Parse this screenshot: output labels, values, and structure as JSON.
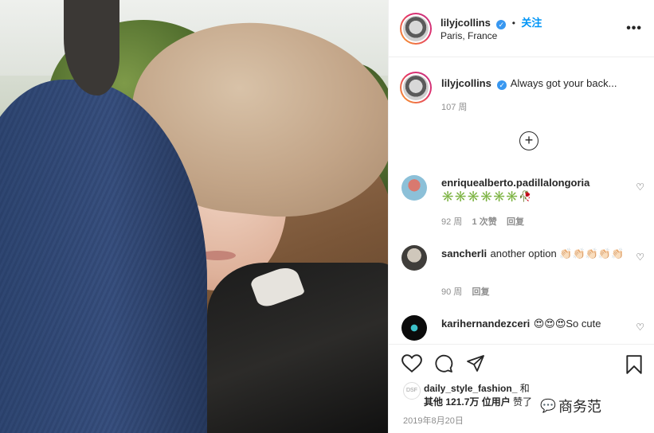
{
  "post": {
    "username": "lilyjcollins",
    "verified_mark": "✓",
    "follow_label": "关注",
    "separator": "•",
    "location": "Paris, France",
    "more_icon": "more-dots-icon"
  },
  "caption": {
    "username": "lilyjcollins",
    "text": "Always got your back...",
    "age": "107 周"
  },
  "load_more_icon": "plus-circle-icon",
  "comments": [
    {
      "username": "enriquealberto.padillalongoria",
      "text": "✳️✳️✳️✳️✳️✳️🥀",
      "age": "92 周",
      "likes": "1 次赞",
      "reply": "回复"
    },
    {
      "username": "sancherli",
      "text": "another option 👏🏻👏🏻👏🏻👏🏻👏🏻",
      "age": "90 周",
      "reply": "回复"
    },
    {
      "username": "karihernandezceri",
      "text": "😍😍😍So cute"
    }
  ],
  "actions": {
    "like_icon": "heart-icon",
    "comment_icon": "comment-icon",
    "share_icon": "paper-plane-icon",
    "save_icon": "bookmark-icon"
  },
  "likes_line1": "daily_style_fashion_",
  "likes_and": " 和",
  "likes_line2": "其他 121.7万 位用户",
  "likes_suffix": " 赞了",
  "date": "2019年8月20日",
  "watermark": "商务范",
  "colors": {
    "link": "#0095f6",
    "verified": "#3897f0",
    "muted": "#8e8e8e"
  }
}
